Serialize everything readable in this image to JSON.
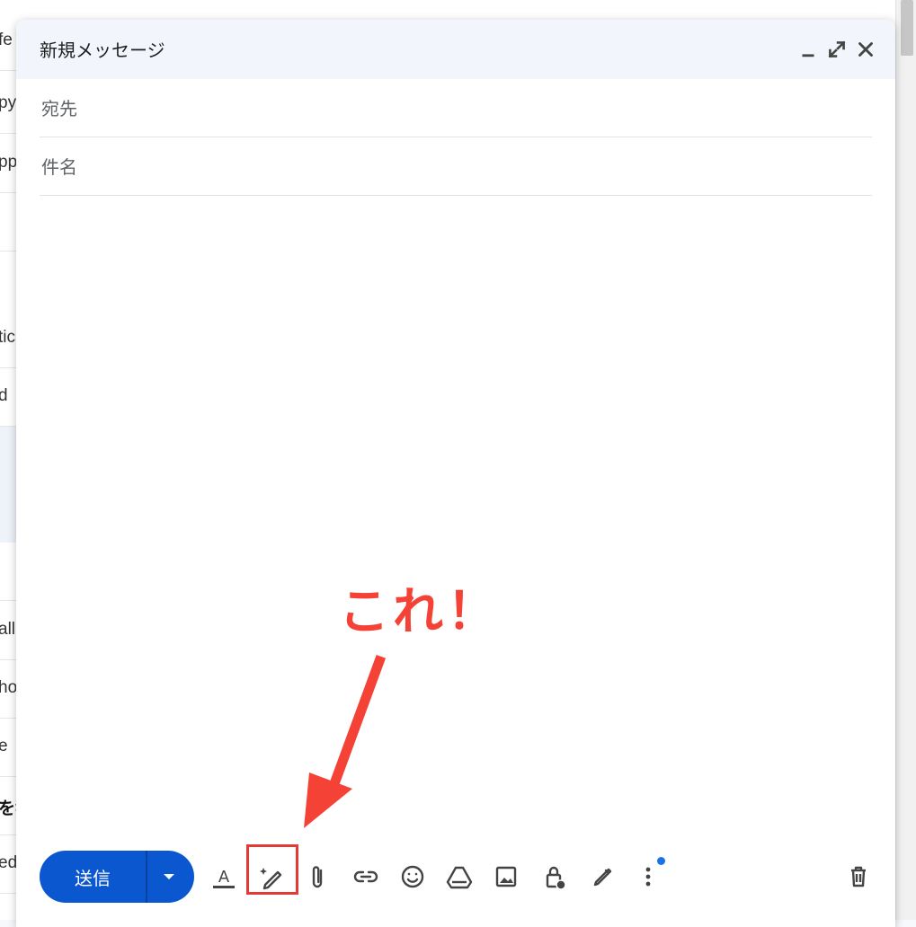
{
  "background_list": {
    "rows": [
      {
        "text": "fe",
        "bold": false
      },
      {
        "text": "py",
        "bold": false
      },
      {
        "text": "pp",
        "bold": false
      },
      {
        "text": "",
        "bold": false
      },
      {
        "text": "tic",
        "bold": false
      },
      {
        "text": " d",
        "bold": false
      },
      {
        "text": "",
        "bold": false
      },
      {
        "text": "",
        "bold": false
      },
      {
        "text": "all",
        "bold": false
      },
      {
        "text": "ho",
        "bold": false
      },
      {
        "text": "e",
        "bold": false
      },
      {
        "text": "を獲",
        "bold": true
      },
      {
        "text": "ed",
        "bold": false
      }
    ]
  },
  "compose": {
    "title": "新規メッセージ",
    "to_placeholder": "宛先",
    "subject_placeholder": "件名",
    "send_label": "送信",
    "header_icons": [
      "minimize-icon",
      "expand-icon",
      "close-icon"
    ],
    "toolbar_icons": [
      "format-text-icon",
      "help-me-write-icon",
      "attach-icon",
      "link-icon",
      "emoji-icon",
      "drive-icon",
      "photo-icon",
      "confidential-icon",
      "signature-icon",
      "more-options-icon",
      "delete-icon"
    ],
    "notification_dot_color": "#1a73e8"
  },
  "annotation": {
    "text": "これ！",
    "color": "#f44336"
  },
  "colors": {
    "send_button": "#0b57d0",
    "header_bg": "#f2f6fc"
  }
}
